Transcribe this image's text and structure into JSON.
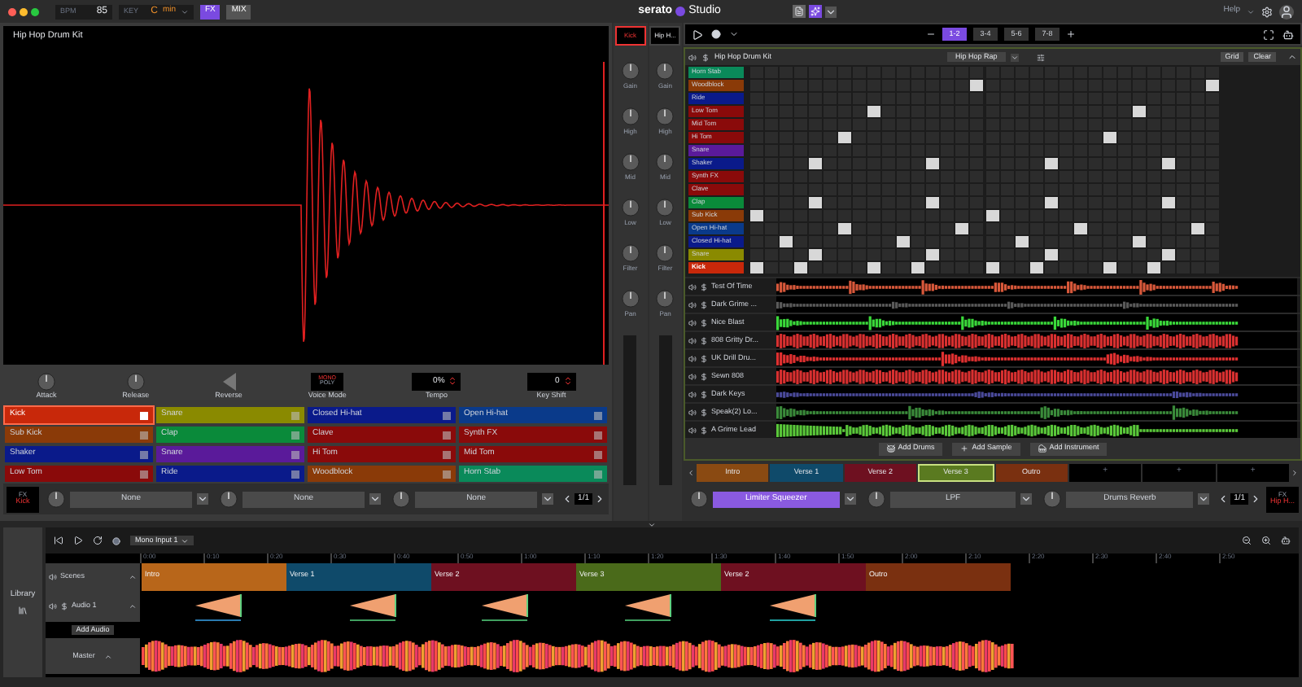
{
  "top_bar": {
    "bpm_label": "BPM",
    "bpm": "85",
    "key_label": "KEY",
    "key": "C",
    "scale": "min",
    "mode_buttons": [
      {
        "label": "FX",
        "selected": true
      },
      {
        "label": "MIX",
        "selected": false
      }
    ],
    "logo": {
      "brand": "serato",
      "product": "Studio"
    },
    "help": "Help"
  },
  "sample_editor": {
    "title": "Hip Hop Drum Kit",
    "controls": [
      {
        "kind": "knob",
        "label": "Attack"
      },
      {
        "kind": "knob",
        "label": "Release"
      },
      {
        "kind": "toggle",
        "label": "Reverse",
        "on": false
      },
      {
        "kind": "mode",
        "label": "Voice Mode",
        "options": [
          {
            "label": "MONO",
            "selected": true
          },
          {
            "label": "POLY",
            "selected": false
          }
        ]
      },
      {
        "kind": "value",
        "label": "Tempo",
        "value": "0%"
      },
      {
        "kind": "value",
        "label": "Key Shift",
        "value": "0"
      }
    ]
  },
  "pads": [
    {
      "label": "Kick",
      "color": "#c8280a",
      "selected": true
    },
    {
      "label": "Snare",
      "color": "#8a8a00",
      "selected": false
    },
    {
      "label": "Closed Hi-hat",
      "color": "#0a1a8a",
      "selected": false
    },
    {
      "label": "Open Hi-hat",
      "color": "#0a3a8a",
      "selected": false
    },
    {
      "label": "Sub Kick",
      "color": "#8a3a08",
      "selected": false
    },
    {
      "label": "Clap",
      "color": "#0a8a3a",
      "selected": false
    },
    {
      "label": "Clave",
      "color": "#8a0a0a",
      "selected": false
    },
    {
      "label": "Synth FX",
      "color": "#8a0a0a",
      "selected": false
    },
    {
      "label": "Shaker",
      "color": "#0a1a8a",
      "selected": false
    },
    {
      "label": "Snare",
      "color": "#5a1a9a",
      "selected": false
    },
    {
      "label": "Hi Tom",
      "color": "#8a0a0a",
      "selected": false
    },
    {
      "label": "Mid Tom",
      "color": "#8a0a0a",
      "selected": false
    },
    {
      "label": "Low Tom",
      "color": "#8a0a0a",
      "selected": false
    },
    {
      "label": "Ride",
      "color": "#0a1a8a",
      "selected": false
    },
    {
      "label": "Woodblock",
      "color": "#8a3a08",
      "selected": false
    },
    {
      "label": "Horn Stab",
      "color": "#0a8a5a",
      "selected": false
    }
  ],
  "left_fx": {
    "label": "FX",
    "channel": "Kick",
    "slots": [
      {
        "label": "None",
        "active": false
      },
      {
        "label": "None",
        "active": false
      },
      {
        "label": "None",
        "active": false
      }
    ],
    "bank": "1/1"
  },
  "mixer": [
    {
      "channel": "Kick",
      "selected": true,
      "knobs": [
        {
          "label": "Gain"
        },
        {
          "label": "High"
        },
        {
          "label": "Mid"
        },
        {
          "label": "Low"
        },
        {
          "label": "Filter"
        },
        {
          "label": "Pan"
        }
      ]
    },
    {
      "channel": "Hip H...",
      "selected": false,
      "knobs": [
        {
          "label": "Gain"
        },
        {
          "label": "High"
        },
        {
          "label": "Mid"
        },
        {
          "label": "Low"
        },
        {
          "label": "Filter"
        },
        {
          "label": "Pan"
        }
      ]
    }
  ],
  "transport": {
    "tabs": [
      {
        "label": "1-2",
        "selected": true
      },
      {
        "label": "3-4",
        "selected": false
      },
      {
        "label": "5-6",
        "selected": false
      },
      {
        "label": "7-8",
        "selected": false
      }
    ]
  },
  "drum_machine": {
    "title": "Hip Hop Drum Kit",
    "kit": "Hip Hop Rap",
    "buttons": [
      "Grid",
      "Clear"
    ],
    "rows": [
      {
        "label": "Horn Stab",
        "color": "#0a8a5a",
        "selected": false,
        "steps": [
          false,
          false,
          false,
          false,
          false,
          false,
          false,
          false,
          false,
          false,
          false,
          false,
          false,
          false,
          false,
          false,
          false,
          false,
          false,
          false,
          false,
          false,
          false,
          false,
          false,
          false,
          false,
          false,
          false,
          false,
          false,
          false
        ]
      },
      {
        "label": "Woodblock",
        "color": "#8a3a08",
        "selected": false,
        "steps": [
          false,
          false,
          false,
          false,
          false,
          false,
          false,
          false,
          false,
          false,
          false,
          false,
          false,
          false,
          false,
          true,
          false,
          false,
          false,
          false,
          false,
          false,
          false,
          false,
          false,
          false,
          false,
          false,
          false,
          false,
          false,
          true
        ]
      },
      {
        "label": "Ride",
        "color": "#0a1a8a",
        "selected": false,
        "steps": [
          false,
          false,
          false,
          false,
          false,
          false,
          false,
          false,
          false,
          false,
          false,
          false,
          false,
          false,
          false,
          false,
          false,
          false,
          false,
          false,
          false,
          false,
          false,
          false,
          false,
          false,
          false,
          false,
          false,
          false,
          false,
          false
        ]
      },
      {
        "label": "Low Tom",
        "color": "#8a0a0a",
        "selected": false,
        "steps": [
          false,
          false,
          false,
          false,
          false,
          false,
          false,
          false,
          true,
          false,
          false,
          false,
          false,
          false,
          false,
          false,
          false,
          false,
          false,
          false,
          false,
          false,
          false,
          false,
          false,
          false,
          true,
          false,
          false,
          false,
          false,
          false
        ]
      },
      {
        "label": "Mid Tom",
        "color": "#8a0a0a",
        "selected": false,
        "steps": [
          false,
          false,
          false,
          false,
          false,
          false,
          false,
          false,
          false,
          false,
          false,
          false,
          false,
          false,
          false,
          false,
          false,
          false,
          false,
          false,
          false,
          false,
          false,
          false,
          false,
          false,
          false,
          false,
          false,
          false,
          false,
          false
        ]
      },
      {
        "label": "Hi Tom",
        "color": "#8a0a0a",
        "selected": false,
        "steps": [
          false,
          false,
          false,
          false,
          false,
          false,
          true,
          false,
          false,
          false,
          false,
          false,
          false,
          false,
          false,
          false,
          false,
          false,
          false,
          false,
          false,
          false,
          false,
          false,
          true,
          false,
          false,
          false,
          false,
          false,
          false,
          false
        ]
      },
      {
        "label": "Snare",
        "color": "#5a1a9a",
        "selected": false,
        "steps": [
          false,
          false,
          false,
          false,
          false,
          false,
          false,
          false,
          false,
          false,
          false,
          false,
          false,
          false,
          false,
          false,
          false,
          false,
          false,
          false,
          false,
          false,
          false,
          false,
          false,
          false,
          false,
          false,
          false,
          false,
          false,
          false
        ]
      },
      {
        "label": "Shaker",
        "color": "#0a1a8a",
        "selected": false,
        "steps": [
          false,
          false,
          false,
          false,
          true,
          false,
          false,
          false,
          false,
          false,
          false,
          false,
          true,
          false,
          false,
          false,
          false,
          false,
          false,
          false,
          true,
          false,
          false,
          false,
          false,
          false,
          false,
          false,
          true,
          false,
          false,
          false
        ]
      },
      {
        "label": "Synth FX",
        "color": "#8a0a0a",
        "selected": false,
        "steps": [
          false,
          false,
          false,
          false,
          false,
          false,
          false,
          false,
          false,
          false,
          false,
          false,
          false,
          false,
          false,
          false,
          false,
          false,
          false,
          false,
          false,
          false,
          false,
          false,
          false,
          false,
          false,
          false,
          false,
          false,
          false,
          false
        ]
      },
      {
        "label": "Clave",
        "color": "#8a0a0a",
        "selected": false,
        "steps": [
          false,
          false,
          false,
          false,
          false,
          false,
          false,
          false,
          false,
          false,
          false,
          false,
          false,
          false,
          false,
          false,
          false,
          false,
          false,
          false,
          false,
          false,
          false,
          false,
          false,
          false,
          false,
          false,
          false,
          false,
          false,
          false
        ]
      },
      {
        "label": "Clap",
        "color": "#0a8a3a",
        "selected": false,
        "steps": [
          false,
          false,
          false,
          false,
          true,
          false,
          false,
          false,
          false,
          false,
          false,
          false,
          true,
          false,
          false,
          false,
          false,
          false,
          false,
          false,
          true,
          false,
          false,
          false,
          false,
          false,
          false,
          false,
          true,
          false,
          false,
          false
        ]
      },
      {
        "label": "Sub Kick",
        "color": "#8a3a08",
        "selected": false,
        "steps": [
          true,
          false,
          false,
          false,
          false,
          false,
          false,
          false,
          false,
          false,
          false,
          false,
          false,
          false,
          false,
          false,
          true,
          false,
          false,
          false,
          false,
          false,
          false,
          false,
          false,
          false,
          false,
          false,
          false,
          false,
          false,
          false
        ]
      },
      {
        "label": "Open Hi-hat",
        "color": "#0a3a8a",
        "selected": false,
        "steps": [
          false,
          false,
          false,
          false,
          false,
          false,
          true,
          false,
          false,
          false,
          false,
          false,
          false,
          false,
          true,
          false,
          false,
          false,
          false,
          false,
          false,
          false,
          true,
          false,
          false,
          false,
          false,
          false,
          false,
          false,
          true,
          false
        ]
      },
      {
        "label": "Closed Hi-hat",
        "color": "#0a1a8a",
        "selected": false,
        "steps": [
          false,
          false,
          true,
          false,
          false,
          false,
          false,
          false,
          false,
          false,
          true,
          false,
          false,
          false,
          false,
          false,
          false,
          false,
          true,
          false,
          false,
          false,
          false,
          false,
          false,
          false,
          true,
          false,
          false,
          false,
          false,
          false
        ]
      },
      {
        "label": "Snare",
        "color": "#8a8a00",
        "selected": false,
        "steps": [
          false,
          false,
          false,
          false,
          true,
          false,
          false,
          false,
          false,
          false,
          false,
          false,
          true,
          false,
          false,
          false,
          false,
          false,
          false,
          false,
          true,
          false,
          false,
          false,
          false,
          false,
          false,
          false,
          true,
          false,
          false,
          false
        ]
      },
      {
        "label": "Kick",
        "color": "#c8280a",
        "selected": true,
        "steps": [
          true,
          false,
          false,
          true,
          false,
          false,
          false,
          false,
          true,
          false,
          false,
          true,
          false,
          false,
          false,
          false,
          true,
          false,
          false,
          true,
          false,
          false,
          false,
          false,
          true,
          false,
          false,
          true,
          false,
          false,
          false,
          false
        ]
      }
    ]
  },
  "tracks": [
    {
      "name": "Test Of Time",
      "color": "#d8583a"
    },
    {
      "name": "Dark Grime ...",
      "color": "#5a5a5a"
    },
    {
      "name": "Nice Blast",
      "color": "#3ad83a"
    },
    {
      "name": "808 Gritty Dr...",
      "color": "#d83030"
    },
    {
      "name": "UK Drill Dru...",
      "color": "#e03030"
    },
    {
      "name": "Sewn 808",
      "color": "#d83030"
    },
    {
      "name": "Dark Keys",
      "color": "#4a4a9a"
    },
    {
      "name": "Speak(2) Lo...",
      "color": "#3a8a3a"
    },
    {
      "name": "A Grime Lead",
      "color": "#5ac83a"
    }
  ],
  "add_buttons": [
    "Add Drums",
    "Add Sample",
    "Add Instrument"
  ],
  "scenes": [
    {
      "label": "Intro",
      "color": "#8a4a12",
      "selected": false
    },
    {
      "label": "Verse 1",
      "color": "#0f4a6a",
      "selected": false
    },
    {
      "label": "Verse 2",
      "color": "#6e1020",
      "selected": false
    },
    {
      "label": "Verse 3",
      "color": "#5a7a20",
      "selected": true
    },
    {
      "label": "Outro",
      "color": "#7a3010",
      "selected": false
    }
  ],
  "empty_scenes": [
    "+",
    "+",
    "+"
  ],
  "right_fx": {
    "label": "FX",
    "channel": "Hip H...",
    "slots": [
      {
        "label": "Limiter Squeezer",
        "active": true
      },
      {
        "label": "LPF",
        "active": false
      },
      {
        "label": "Drums Reverb",
        "active": false
      }
    ],
    "bank": "1/1"
  },
  "arrange": {
    "library": "Library",
    "input": "Mono Input 1",
    "ruler": [
      "0:00",
      "0:10",
      "0:20",
      "0:30",
      "0:40",
      "0:50",
      "1:00",
      "1:10",
      "1:20",
      "1:30",
      "1:40",
      "1:50",
      "2:00",
      "2:10",
      "2:20",
      "2:30",
      "2:40",
      "2:50"
    ],
    "track_labels": [
      "Scenes",
      "Audio 1"
    ],
    "add_audio": "Add Audio",
    "master": "Master",
    "scenes": [
      {
        "label": "Intro",
        "color": "#b8661a"
      },
      {
        "label": "Verse 1",
        "color": "#0f4a6a"
      },
      {
        "label": "Verse 2",
        "color": "#6e1020"
      },
      {
        "label": "Verse 3",
        "color": "#4a6a1a"
      },
      {
        "label": "Verse 2",
        "color": "#6e1020"
      },
      {
        "label": "Outro",
        "color": "#7a3010"
      }
    ]
  }
}
